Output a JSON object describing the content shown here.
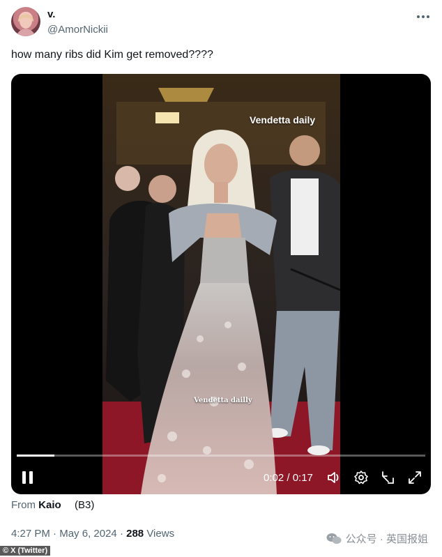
{
  "author": {
    "name": "v.",
    "handle": "@AmorNickii"
  },
  "more_icon": "more-dots-icon",
  "tweet": {
    "text": "how many ribs did Kim get removed????"
  },
  "video": {
    "overlay_top": "Vendetta daily",
    "overlay_mid": "Vendetta dailly",
    "current_time": "0:02",
    "duration": "0:17",
    "time_display": "0:02 / 0:17",
    "progress": 0.093,
    "icons": [
      "pause-icon",
      "volume-icon",
      "settings-gear-icon",
      "exit-fullscreen-icon",
      "fullscreen-icon"
    ]
  },
  "source": {
    "prefix": "From",
    "name": "Kaio",
    "tag": "(B3)"
  },
  "meta": {
    "time": "4:27 PM",
    "date": "May 6, 2024",
    "views_count": "288",
    "views_label": "Views"
  },
  "watermark": {
    "text": "公众号 · 英国报姐",
    "icon": "wechat-icon"
  },
  "credit": {
    "text": "© X (Twitter)"
  },
  "colors": {
    "text": "#0f1419",
    "secondary": "#536471",
    "carpet": "#8d1727"
  }
}
